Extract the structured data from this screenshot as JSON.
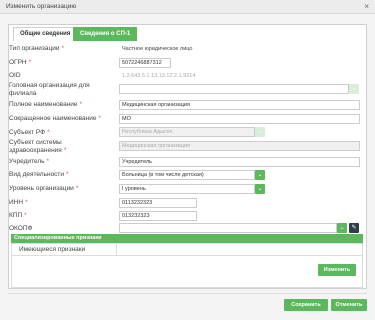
{
  "window": {
    "title": "Изменить организацию",
    "close_glyph": "×"
  },
  "tabs": [
    {
      "label": "Общие сведения"
    },
    {
      "label": "Сведения о СП-1"
    }
  ],
  "form": {
    "org_type": {
      "label": "Тип организации",
      "value": "Частное юридическое лицо"
    },
    "ogrn": {
      "label": "ОГРН",
      "value": "5072246887312"
    },
    "oid": {
      "label": "OID",
      "value": "1.2.643.5.1.13.13.12.2.1.9214"
    },
    "head_org": {
      "label": "Головная организация для филиала",
      "value": ""
    },
    "full_name": {
      "label": "Полное наименование",
      "value": "Медицинская организация"
    },
    "short_name": {
      "label": "Сокращенное наименование",
      "value": "МО"
    },
    "subject": {
      "label": "Субъект РФ",
      "value": "Республика Адыгея"
    },
    "health_system": {
      "label": "Субъект системы здравоохранения",
      "value": "Медицинская организация"
    },
    "founder": {
      "label": "Учредитель",
      "value": "Учредитель"
    },
    "activity": {
      "label": "Вид деятельности",
      "value": "Больница (в том числе детская)"
    },
    "level": {
      "label": "Уровень организации",
      "value": "I уровень"
    },
    "inn": {
      "label": "ИНН",
      "value": "0113232323"
    },
    "kpp": {
      "label": "КПП",
      "value": "013232323"
    },
    "okopf": {
      "label": "ОКОПФ",
      "value": ""
    }
  },
  "required_mark": "*",
  "icons": {
    "chevron": "chevron-down-icon",
    "eraser": "eraser-icon"
  },
  "glyphs": {
    "chevron": "⌄",
    "eraser": "✎"
  },
  "features": {
    "header": "Специализированные признаки",
    "column": "Имеющиеся признаки",
    "edit_label": "Изменить"
  },
  "footer": {
    "save_label": "Сохранить",
    "cancel_label": "Отменить"
  },
  "colors": {
    "accent": "#5cb85c",
    "dark_button": "#2f3e46",
    "required": "#d9534f"
  }
}
